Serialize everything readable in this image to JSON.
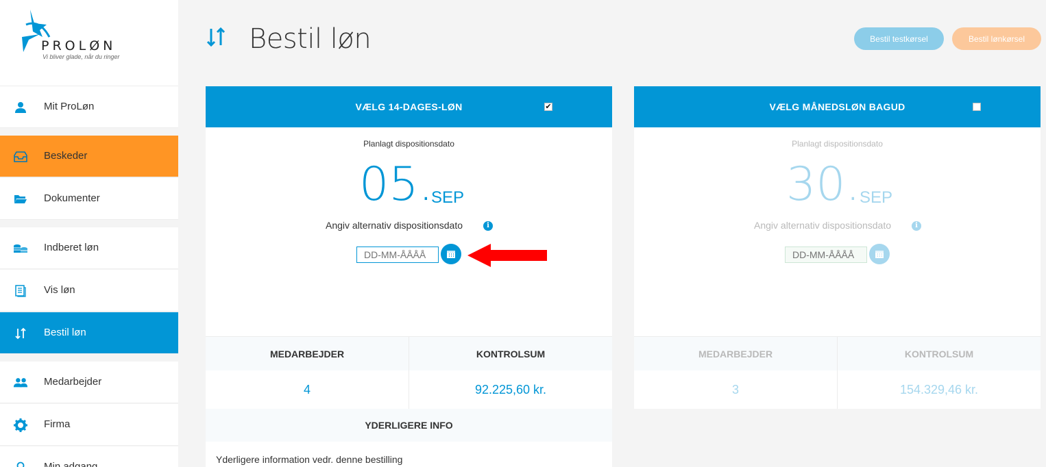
{
  "brand": {
    "name": "PROLØN",
    "tagline": "Vi bliver glade, når du ringer",
    "accent": "#0296d6",
    "orange": "#ff9524"
  },
  "sidebar": {
    "items": [
      {
        "label": "Mit ProLøn",
        "icon": "user-icon"
      },
      {
        "label": "Beskeder",
        "icon": "inbox-icon"
      },
      {
        "label": "Dokumenter",
        "icon": "folder-icon"
      },
      {
        "label": "Indberet løn",
        "icon": "coins-icon"
      },
      {
        "label": "Vis løn",
        "icon": "document-icon"
      },
      {
        "label": "Bestil løn",
        "icon": "sort-arrows-icon"
      },
      {
        "label": "Medarbejder",
        "icon": "users-icon"
      },
      {
        "label": "Firma",
        "icon": "gear-icon"
      },
      {
        "label": "Min adgang",
        "icon": "key-icon"
      }
    ]
  },
  "header": {
    "title": "Bestil løn",
    "btn_test": "Bestil testkørsel",
    "btn_lon": "Bestil lønkørsel"
  },
  "card1": {
    "title": "VÆLG 14-DAGES-LØN",
    "checked": "✔",
    "planned_label": "Planlagt dispositionsdato",
    "day": "05.",
    "month": "SEP",
    "alt_label": "Angiv alternativ dispositionsdato",
    "info": "i",
    "date_placeholder": "DD-MM-ÅÅÅÅ",
    "col1_head": "MEDARBEJDER",
    "col2_head": "KONTROLSUM",
    "col1_val": "4",
    "col2_val": "92.225,60 kr.",
    "more_head": "YDERLIGERE INFO",
    "more_text": "Yderligere information vedr. denne bestilling"
  },
  "card2": {
    "title": "VÆLG MÅNEDSLØN BAGUD",
    "planned_label": "Planlagt dispositionsdato",
    "day": "30.",
    "month": "SEP",
    "alt_label": "Angiv alternativ dispositionsdato",
    "info": "i",
    "date_placeholder": "DD-MM-ÅÅÅÅ",
    "col1_head": "MEDARBEJDER",
    "col2_head": "KONTROLSUM",
    "col1_val": "3",
    "col2_val": "154.329,46 kr."
  }
}
